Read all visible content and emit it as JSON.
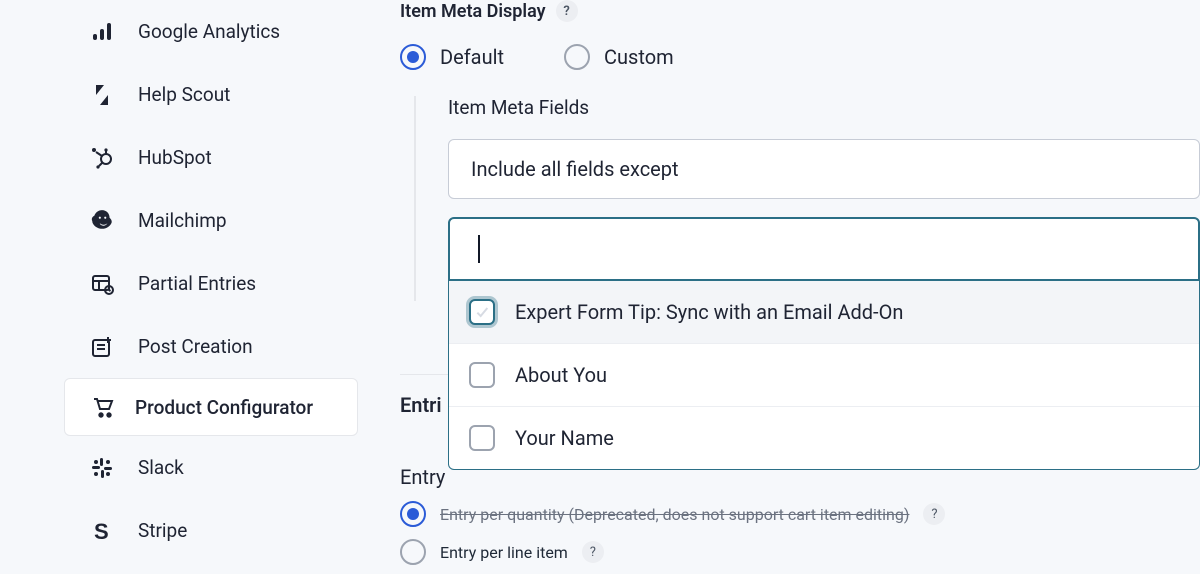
{
  "sidebar": {
    "items": [
      {
        "label": "Google Analytics",
        "icon": "analytics"
      },
      {
        "label": "Help Scout",
        "icon": "helpscout"
      },
      {
        "label": "HubSpot",
        "icon": "hubspot"
      },
      {
        "label": "Mailchimp",
        "icon": "mailchimp"
      },
      {
        "label": "Partial Entries",
        "icon": "partial"
      },
      {
        "label": "Post Creation",
        "icon": "post"
      },
      {
        "label": "Product Configurator",
        "icon": "cart",
        "active": true
      },
      {
        "label": "Slack",
        "icon": "slack"
      },
      {
        "label": "Stripe",
        "icon": "stripe"
      }
    ]
  },
  "main": {
    "meta_display": {
      "label": "Item Meta Display",
      "options": {
        "default": "Default",
        "custom": "Custom"
      },
      "selected": "default"
    },
    "meta_fields": {
      "label": "Item Meta Fields",
      "select_value": "Include all fields except",
      "search_value": "",
      "options": [
        {
          "label": "Expert Form Tip: Sync with an Email Add-On",
          "highlight": true
        },
        {
          "label": "About You"
        },
        {
          "label": "Your Name"
        }
      ]
    },
    "entries": {
      "title": "Entri",
      "creation_label": "Entry",
      "options": {
        "per_quantity": "Entry per quantity (Deprecated, does not support cart item editing)",
        "per_line": "Entry per line item"
      },
      "selected": "per_quantity"
    }
  }
}
